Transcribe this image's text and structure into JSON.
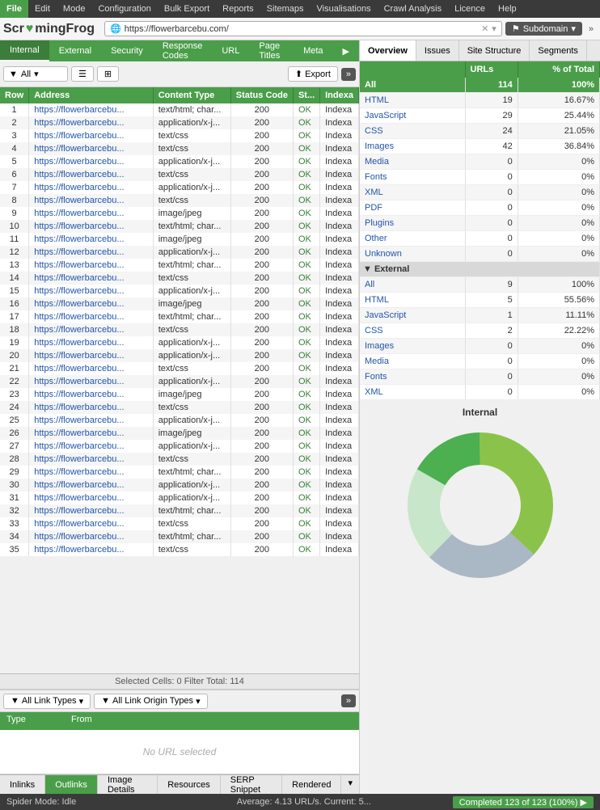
{
  "menubar": {
    "app": "File",
    "items": [
      "File",
      "Edit",
      "Mode",
      "Configuration",
      "Bulk Export",
      "Reports",
      "Sitemaps",
      "Visualisations",
      "Crawl Analysis",
      "Licence",
      "Help"
    ]
  },
  "addressbar": {
    "logo": "Scr♥mingFrog",
    "url": "https://flowerbarcebu.com/",
    "mode": "Subdomain"
  },
  "tabs": {
    "left": [
      "Internal",
      "External",
      "Security",
      "Response Codes",
      "URL",
      "Page Titles",
      "Meta"
    ],
    "activeLeft": "Internal"
  },
  "rightTabs": [
    "Overview",
    "Issues",
    "Site Structure",
    "Segments"
  ],
  "activeRightTab": "Overview",
  "toolbar": {
    "filter": "All",
    "export": "Export"
  },
  "tableHeaders": [
    "Row",
    "Address",
    "Content Type",
    "Status Code",
    "St...",
    "Indexa"
  ],
  "rows": [
    {
      "row": 1,
      "address": "https://flowerbarcebu...",
      "type": "text/html; char...",
      "code": 200,
      "status": "OK",
      "index": "Indexa"
    },
    {
      "row": 2,
      "address": "https://flowerbarcebu...",
      "type": "application/x-j...",
      "code": 200,
      "status": "OK",
      "index": "Indexa"
    },
    {
      "row": 3,
      "address": "https://flowerbarcebu...",
      "type": "text/css",
      "code": 200,
      "status": "OK",
      "index": "Indexa"
    },
    {
      "row": 4,
      "address": "https://flowerbarcebu...",
      "type": "text/css",
      "code": 200,
      "status": "OK",
      "index": "Indexa"
    },
    {
      "row": 5,
      "address": "https://flowerbarcebu...",
      "type": "application/x-j...",
      "code": 200,
      "status": "OK",
      "index": "Indexa"
    },
    {
      "row": 6,
      "address": "https://flowerbarcebu...",
      "type": "text/css",
      "code": 200,
      "status": "OK",
      "index": "Indexa"
    },
    {
      "row": 7,
      "address": "https://flowerbarcebu...",
      "type": "application/x-j...",
      "code": 200,
      "status": "OK",
      "index": "Indexa"
    },
    {
      "row": 8,
      "address": "https://flowerbarcebu...",
      "type": "text/css",
      "code": 200,
      "status": "OK",
      "index": "Indexa"
    },
    {
      "row": 9,
      "address": "https://flowerbarcebu...",
      "type": "image/jpeg",
      "code": 200,
      "status": "OK",
      "index": "Indexa"
    },
    {
      "row": 10,
      "address": "https://flowerbarcebu...",
      "type": "text/html; char...",
      "code": 200,
      "status": "OK",
      "index": "Indexa"
    },
    {
      "row": 11,
      "address": "https://flowerbarcebu...",
      "type": "image/jpeg",
      "code": 200,
      "status": "OK",
      "index": "Indexa"
    },
    {
      "row": 12,
      "address": "https://flowerbarcebu...",
      "type": "application/x-j...",
      "code": 200,
      "status": "OK",
      "index": "Indexa"
    },
    {
      "row": 13,
      "address": "https://flowerbarcebu...",
      "type": "text/html; char...",
      "code": 200,
      "status": "OK",
      "index": "Indexa"
    },
    {
      "row": 14,
      "address": "https://flowerbarcebu...",
      "type": "text/css",
      "code": 200,
      "status": "OK",
      "index": "Indexa"
    },
    {
      "row": 15,
      "address": "https://flowerbarcebu...",
      "type": "application/x-j...",
      "code": 200,
      "status": "OK",
      "index": "Indexa"
    },
    {
      "row": 16,
      "address": "https://flowerbarcebu...",
      "type": "image/jpeg",
      "code": 200,
      "status": "OK",
      "index": "Indexa"
    },
    {
      "row": 17,
      "address": "https://flowerbarcebu...",
      "type": "text/html; char...",
      "code": 200,
      "status": "OK",
      "index": "Indexa"
    },
    {
      "row": 18,
      "address": "https://flowerbarcebu...",
      "type": "text/css",
      "code": 200,
      "status": "OK",
      "index": "Indexa"
    },
    {
      "row": 19,
      "address": "https://flowerbarcebu...",
      "type": "application/x-j...",
      "code": 200,
      "status": "OK",
      "index": "Indexa"
    },
    {
      "row": 20,
      "address": "https://flowerbarcebu...",
      "type": "application/x-j...",
      "code": 200,
      "status": "OK",
      "index": "Indexa"
    },
    {
      "row": 21,
      "address": "https://flowerbarcebu...",
      "type": "text/css",
      "code": 200,
      "status": "OK",
      "index": "Indexa"
    },
    {
      "row": 22,
      "address": "https://flowerbarcebu...",
      "type": "application/x-j...",
      "code": 200,
      "status": "OK",
      "index": "Indexa"
    },
    {
      "row": 23,
      "address": "https://flowerbarcebu...",
      "type": "image/jpeg",
      "code": 200,
      "status": "OK",
      "index": "Indexa"
    },
    {
      "row": 24,
      "address": "https://flowerbarcebu...",
      "type": "text/css",
      "code": 200,
      "status": "OK",
      "index": "Indexa"
    },
    {
      "row": 25,
      "address": "https://flowerbarcebu...",
      "type": "application/x-j...",
      "code": 200,
      "status": "OK",
      "index": "Indexa"
    },
    {
      "row": 26,
      "address": "https://flowerbarcebu...",
      "type": "image/jpeg",
      "code": 200,
      "status": "OK",
      "index": "Indexa"
    },
    {
      "row": 27,
      "address": "https://flowerbarcebu...",
      "type": "application/x-j...",
      "code": 200,
      "status": "OK",
      "index": "Indexa"
    },
    {
      "row": 28,
      "address": "https://flowerbarcebu...",
      "type": "text/css",
      "code": 200,
      "status": "OK",
      "index": "Indexa"
    },
    {
      "row": 29,
      "address": "https://flowerbarcebu...",
      "type": "text/html; char...",
      "code": 200,
      "status": "OK",
      "index": "Indexa"
    },
    {
      "row": 30,
      "address": "https://flowerbarcebu...",
      "type": "application/x-j...",
      "code": 200,
      "status": "OK",
      "index": "Indexa"
    },
    {
      "row": 31,
      "address": "https://flowerbarcebu...",
      "type": "application/x-j...",
      "code": 200,
      "status": "OK",
      "index": "Indexa"
    },
    {
      "row": 32,
      "address": "https://flowerbarcebu...",
      "type": "text/html; char...",
      "code": 200,
      "status": "OK",
      "index": "Indexa"
    },
    {
      "row": 33,
      "address": "https://flowerbarcebu...",
      "type": "text/css",
      "code": 200,
      "status": "OK",
      "index": "Indexa"
    },
    {
      "row": 34,
      "address": "https://flowerbarcebu...",
      "type": "text/html; char...",
      "code": 200,
      "status": "OK",
      "index": "Indexa"
    },
    {
      "row": 35,
      "address": "https://flowerbarcebu...",
      "type": "text/css",
      "code": 200,
      "status": "OK",
      "index": "Indexa"
    }
  ],
  "statusBar": "Selected Cells: 0  Filter Total: 114",
  "stats": {
    "internalHeader": "URLs",
    "percentHeader": "% of Total",
    "internalRows": [
      {
        "label": "All",
        "urls": 114,
        "pct": "100%",
        "isAll": true
      },
      {
        "label": "HTML",
        "urls": 19,
        "pct": "16.67%"
      },
      {
        "label": "JavaScript",
        "urls": 29,
        "pct": "25.44%"
      },
      {
        "label": "CSS",
        "urls": 24,
        "pct": "21.05%"
      },
      {
        "label": "Images",
        "urls": 42,
        "pct": "36.84%"
      },
      {
        "label": "Media",
        "urls": 0,
        "pct": "0%"
      },
      {
        "label": "Fonts",
        "urls": 0,
        "pct": "0%"
      },
      {
        "label": "XML",
        "urls": 0,
        "pct": "0%"
      },
      {
        "label": "PDF",
        "urls": 0,
        "pct": "0%"
      },
      {
        "label": "Plugins",
        "urls": 0,
        "pct": "0%"
      },
      {
        "label": "Other",
        "urls": 0,
        "pct": "0%"
      },
      {
        "label": "Unknown",
        "urls": 0,
        "pct": "0%"
      }
    ],
    "externalSection": "External",
    "externalRows": [
      {
        "label": "All",
        "urls": 9,
        "pct": "100%"
      },
      {
        "label": "HTML",
        "urls": 5,
        "pct": "55.56%"
      },
      {
        "label": "JavaScript",
        "urls": 1,
        "pct": "11.11%"
      },
      {
        "label": "CSS",
        "urls": 2,
        "pct": "22.22%"
      },
      {
        "label": "Images",
        "urls": 0,
        "pct": "0%"
      },
      {
        "label": "Media",
        "urls": 0,
        "pct": "0%"
      },
      {
        "label": "Fonts",
        "urls": 0,
        "pct": "0%"
      },
      {
        "label": "XML",
        "urls": 0,
        "pct": "0%"
      }
    ]
  },
  "chart": {
    "title": "Internal",
    "segments": [
      {
        "label": "Images",
        "pct": 36.84,
        "color": "#8bc34a"
      },
      {
        "label": "JavaScript",
        "pct": 25.44,
        "color": "#aab7c4"
      },
      {
        "label": "CSS",
        "pct": 21.05,
        "color": "#c8e6c9"
      },
      {
        "label": "HTML",
        "pct": 16.67,
        "color": "#4caf50"
      }
    ]
  },
  "bottomLinkBar": {
    "linkTypes": "All Link Types",
    "originTypes": "All Link Origin Types",
    "type": "Type",
    "from": "From",
    "noUrl": "No URL selected"
  },
  "bottomTabs": [
    "Inlinks",
    "Outlinks",
    "Image Details",
    "Resources",
    "SERP Snippet",
    "Rendered"
  ],
  "activeBottomTab": "Outlinks",
  "statusBottom": {
    "left": "Spider Mode: Idle",
    "center": "Average: 4.13 URL/s. Current: 5...",
    "right": "Completed 123 of 123 (100%) ▶"
  }
}
